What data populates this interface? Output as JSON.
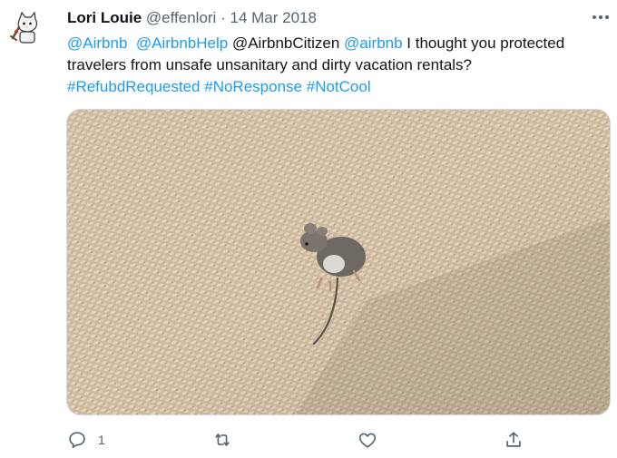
{
  "tweet": {
    "author_name": "Lori Louie",
    "author_handle": "@effenlori",
    "separator": "·",
    "date": "14 Mar 2018",
    "text_parts": [
      {
        "type": "link",
        "text": "@Airbnb"
      },
      {
        "type": "text",
        "text": "  "
      },
      {
        "type": "link",
        "text": "@AirbnbHelp"
      },
      {
        "type": "text",
        "text": " @AirbnbCitizen "
      },
      {
        "type": "link",
        "text": "@airbnb"
      },
      {
        "type": "text",
        "text": " I thought you protected travelers from unsafe unsanitary and dirty vacation rentals?"
      },
      {
        "type": "break"
      },
      {
        "type": "link",
        "text": "#RefubdRequested"
      },
      {
        "type": "text",
        "text": " "
      },
      {
        "type": "link",
        "text": "#NoResponse"
      },
      {
        "type": "text",
        "text": " "
      },
      {
        "type": "link",
        "text": "#NotCool"
      }
    ]
  },
  "actions": {
    "reply_count": "1",
    "retweet_count": "",
    "like_count": ""
  },
  "icons": {
    "more": "more-horizontal-icon",
    "reply": "reply-icon",
    "retweet": "retweet-icon",
    "like": "heart-icon",
    "share": "share-icon"
  },
  "colors": {
    "link": "#1d9bf0",
    "secondary_text": "#536471"
  }
}
